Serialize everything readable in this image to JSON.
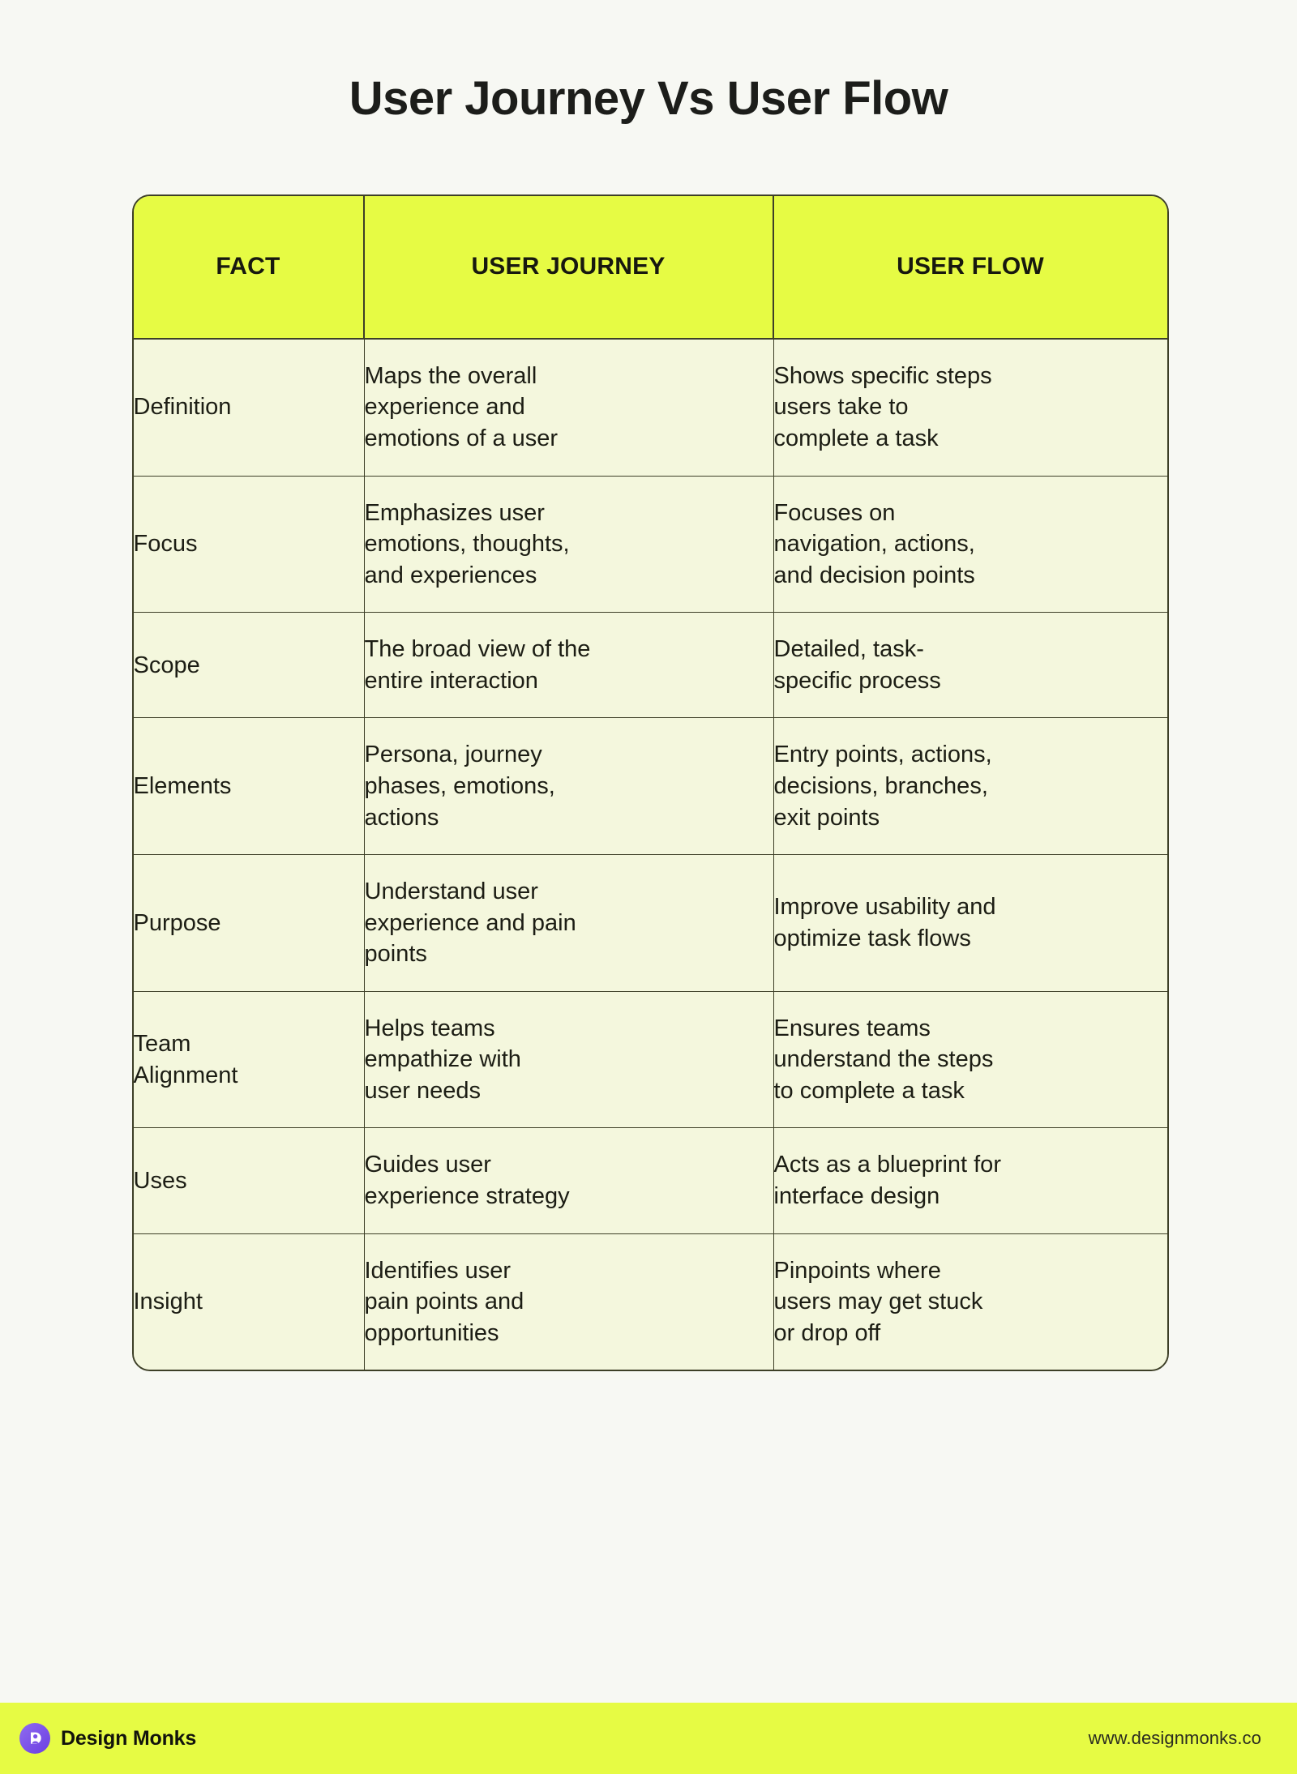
{
  "page": {
    "title": "User Journey Vs User Flow",
    "background_color": "#f7f8f3",
    "accent_color": "#e6fb44",
    "cell_color": "#f4f7dd",
    "border_color": "#3d3f27",
    "text_color": "#1c1d14"
  },
  "table": {
    "headers": [
      "FACT",
      "USER JOURNEY",
      "USER FLOW"
    ],
    "rows": [
      {
        "fact": "Definition",
        "user_journey": "Maps the overall\nexperience and\nemotions of a user",
        "user_flow": "Shows specific steps\nusers take to\ncomplete a task"
      },
      {
        "fact": "Focus",
        "user_journey": "Emphasizes user\nemotions, thoughts,\nand experiences",
        "user_flow": "Focuses on\nnavigation, actions,\nand decision points"
      },
      {
        "fact": "Scope",
        "user_journey": "The broad view of the\nentire interaction",
        "user_flow": "Detailed, task-\nspecific process"
      },
      {
        "fact": "Elements",
        "user_journey": "Persona, journey\nphases, emotions,\nactions",
        "user_flow": "Entry points, actions,\ndecisions, branches,\nexit points"
      },
      {
        "fact": "Purpose",
        "user_journey": "Understand user\nexperience and pain\npoints",
        "user_flow": "Improve usability and\noptimize task flows"
      },
      {
        "fact": "Team\nAlignment",
        "user_journey": "Helps teams\nempathize with\nuser needs",
        "user_flow": "Ensures teams\nunderstand the steps\nto complete a task"
      },
      {
        "fact": "Uses",
        "user_journey": "Guides user\nexperience strategy",
        "user_flow": "Acts as a blueprint for\ninterface design"
      },
      {
        "fact": "Insight",
        "user_journey": "Identifies user\npain points and\nopportunities",
        "user_flow": "Pinpoints where\nusers may get stuck\nor drop off"
      }
    ]
  },
  "footer": {
    "brand_name": "Design Monks",
    "brand_mark_icon": "design-monks-logo-icon",
    "brand_mark_color": "#7b52e8",
    "url": "www.designmonks.co"
  }
}
